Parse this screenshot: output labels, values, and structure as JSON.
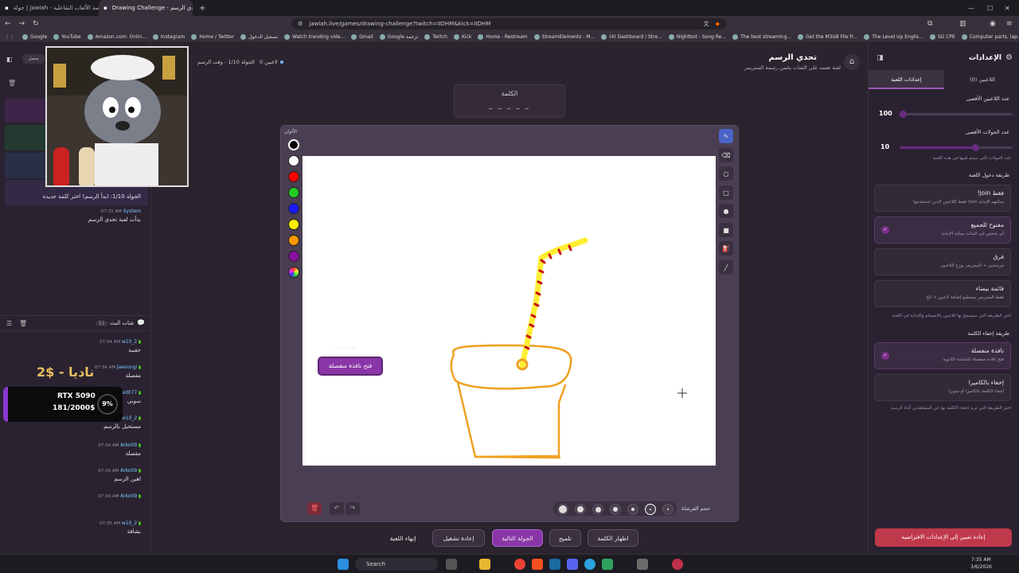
{
  "browser": {
    "tabs": [
      {
        "label": "جولة | Jawlah - منصة الألعاب التفاعلية"
      },
      {
        "label": "Drawing Challenge - تحدي الرسم"
      }
    ],
    "url": "jawlah.live/games/drawing-challenge?twitch=IIDHM&kick=IIDHM",
    "bookmarks": [
      "Google",
      "YouTube",
      "Amazon.com: Onlin...",
      "Instagram",
      "Home / Twitter",
      "تسجيل الدخول",
      "Watch trending vide...",
      "Gmail",
      "Google ترجمة",
      "Twitch",
      "Kick",
      "Home - Restream",
      "StreamElements - M...",
      "(4) Dashboard / Stre...",
      "Nightbot - Song Re...",
      "The best streaming...",
      "Get the M3U8 File fr...",
      "The Level Up Englis...",
      "SG CPE",
      "Computer parts, lap..."
    ]
  },
  "header": {
    "game_title": "تحدي الرسم",
    "game_subtitle": "لعبة تعتمد على الشات يخمن رسمة الستريمر",
    "players_count": "0 لاعبين",
    "round_info": "الجولة 1/10 - وقت الرسم"
  },
  "word_box": {
    "label": "الكلمة",
    "hint": "_ _ _ _ _"
  },
  "palette": {
    "label": "الألوان",
    "colors": [
      "#000000",
      "#ffffff",
      "#ff0000",
      "#22cc22",
      "#1a1aff",
      "#ffee00",
      "#ff9900",
      "#8a0fa0",
      "rainbow"
    ]
  },
  "canvas_bottom": {
    "brush_size_label": "حجم الفرشاة"
  },
  "popup_button": {
    "label": "فتح نافذة منفصلة",
    "faint": "افتح النافذة"
  },
  "chat": {
    "title": "شات البث",
    "count": "51",
    "system_msgs": [
      {
        "text": "الجولة 1/10: ابدأ الرسم! اختر كلمة جديدة"
      },
      {
        "user": "System",
        "time": "07:31 AM",
        "text": "بدأت لعبة تحدي الرسم"
      }
    ],
    "messages": [
      {
        "user": "w10_2",
        "time": "07:34 AM",
        "text": "حقيبة"
      },
      {
        "user": "Jaesungi",
        "time": "07:34 AM",
        "text": "مقصلة"
      },
      {
        "user": "...ed077",
        "time": "",
        "text": "سوني"
      },
      {
        "user": "w10_2",
        "time": "",
        "text": "مستحيل بالرسم"
      },
      {
        "user": "Arko09",
        "time": "07:34 AM",
        "text": "مقصلة"
      },
      {
        "user": "Arko09",
        "time": "07:34 AM",
        "text": "اهين الرسم"
      },
      {
        "user": "Arko09",
        "time": "07:34 AM",
        "text": ""
      },
      {
        "user": "w10_2",
        "time": "07:35 AM",
        "text": "نشافة"
      }
    ]
  },
  "overlays": {
    "donation_text": "2$ - ناديا",
    "goal_title": "RTX 5090",
    "goal_amount": "181/2000$",
    "goal_percent": "9%",
    "goal_progress": 0.09
  },
  "settings": {
    "title": "الإعدادات",
    "tabs": [
      "اللاعبين (0)",
      "إعدادات اللعبة"
    ],
    "max_players_label": "عدد اللاعبين الأقصى",
    "max_players_value": "100",
    "max_players_fraction": 0.0,
    "max_rounds_label": "عدد الجولات الأقصى",
    "max_rounds_value": "10",
    "max_rounds_fraction": 0.5,
    "max_rounds_hint": "عدد الجولات التي سيتم لعبها في هذه اللعبة",
    "join_method_label": "طريقة دخول اللعبة",
    "join_options": [
      {
        "title": "!join فقط",
        "desc": "فقط اللاعبين الذين استخدموا !join يمكنهم الإجابة",
        "checked": false
      },
      {
        "title": "مفتوح للجميع",
        "desc": "أي شخص في الشات يمكنه الإجابة",
        "checked": true
      },
      {
        "title": "فرق",
        "desc": "مرشحين + الستريمر يوزع اللاعبين",
        "checked": false
      },
      {
        "title": "قائمة بيضاء",
        "desc": "فقط الستريمر يستطيع إضافة لاعبين + الخ",
        "checked": false
      }
    ],
    "join_hint": "اختر الطريقة التي سيسمح بها للاعبين بالانضمام والإجابة في اللعبة",
    "hide_method_label": "طريقة إخفاء الكلمة",
    "hide_options": [
      {
        "title": "نافذة منفصلة",
        "desc": "فتح نافذة منفصلة للشاشة الثانوية",
        "checked": true
      },
      {
        "title": "إخفاء بالكاميرا",
        "desc": "إخفاء الكلمة بالكاميرا أو سوبرا",
        "checked": false
      }
    ],
    "hide_hint": "اختر الطريقة التي تريد إخفاء الكلمة بها عن المشاهدين أثناء الرسم",
    "reset_button": "إعادة تعيين إلى الإعدادات الافتراضية"
  },
  "bottom_buttons": [
    "إنهاء اللعبة",
    "إعادة تشغيل",
    "الجولة التالية",
    "تلميح",
    "اظهار الكلمة"
  ],
  "taskbar": {
    "search": "Search",
    "time": "7:35 AM",
    "date": "3/6/2026"
  }
}
